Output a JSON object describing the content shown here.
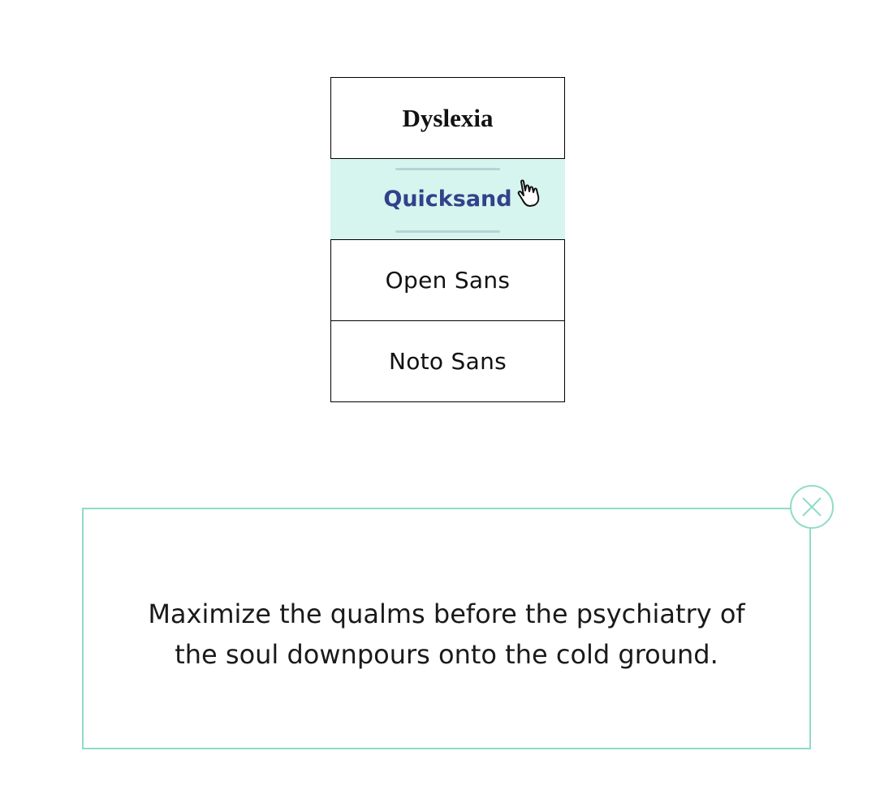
{
  "font_menu": {
    "options": [
      {
        "label": "Dyslexia",
        "selected": false
      },
      {
        "label": "Quicksand",
        "selected": true
      },
      {
        "label": "Open Sans",
        "selected": false
      },
      {
        "label": "Noto Sans",
        "selected": false
      }
    ]
  },
  "preview": {
    "text": "Maximize the qualms before the psychiatry of the soul downpours onto the cold ground."
  },
  "icons": {
    "cursor": "hand-pointer-icon",
    "close": "close-icon"
  },
  "colors": {
    "selected_bg": "#d6f5ee",
    "selected_text": "#34418a",
    "accent_border": "#8fdcc8"
  }
}
